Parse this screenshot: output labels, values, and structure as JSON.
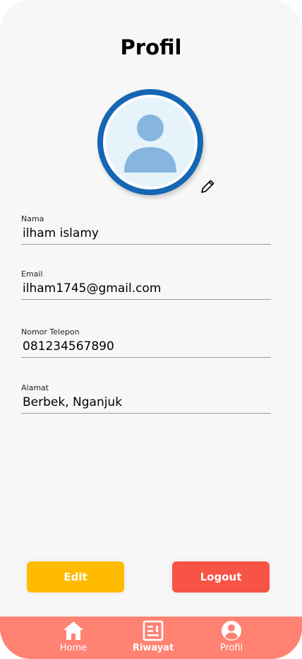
{
  "page": {
    "title": "Profil"
  },
  "fields": [
    {
      "label": "Nama",
      "value": "ilham islamy"
    },
    {
      "label": "Email",
      "value": "ilham1745@gmail.com"
    },
    {
      "label": "Nomor Telepon",
      "value": "081234567890"
    },
    {
      "label": "Alamat",
      "value": "Berbek, Nganjuk"
    }
  ],
  "buttons": {
    "edit": "Edit",
    "logout": "Logout"
  },
  "nav": {
    "items": [
      {
        "label": "Home",
        "icon": "home-icon"
      },
      {
        "label": "Riwayat",
        "icon": "receipt-icon"
      },
      {
        "label": "Profil",
        "icon": "account-circle-icon"
      }
    ],
    "active": "Riwayat"
  },
  "colors": {
    "avatar_ring": "#1566b4",
    "edit_button": "#ffbb00",
    "logout_button": "#f75445",
    "navbar": "#ff8273"
  }
}
